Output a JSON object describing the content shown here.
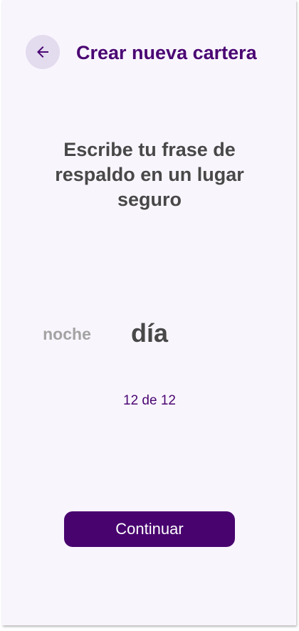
{
  "header": {
    "back_icon": "arrow-left-icon",
    "title": "Crear nueva cartera"
  },
  "main": {
    "heading": "Escribe tu frase de respaldo en un lugar seguro",
    "previous_word": "noche",
    "current_word": "día",
    "progress_text": "12 de 12"
  },
  "footer": {
    "continue_label": "Continuar"
  },
  "colors": {
    "background": "#f9f5fd",
    "accent": "#4a0573",
    "button": "#48036f",
    "back_button_bg": "#e3dbee",
    "text_dark": "#484848",
    "text_muted": "#a3a3a3"
  }
}
